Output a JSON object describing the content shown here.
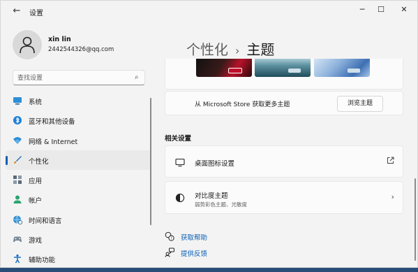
{
  "window": {
    "title": "设置",
    "back_icon": "arrow-left-icon",
    "controls": {
      "minimize": "─",
      "maximize": "☐",
      "close": "✕"
    }
  },
  "user": {
    "name": "xin lin",
    "email": "2442544326@qq.com",
    "avatar_icon": "person-icon"
  },
  "search": {
    "placeholder": "查找设置",
    "icon": "search-icon"
  },
  "sidebar": {
    "items": [
      {
        "label": "系统",
        "icon": "monitor-icon",
        "active": false
      },
      {
        "label": "蓝牙和其他设备",
        "icon": "bluetooth-icon",
        "active": false
      },
      {
        "label": "网络 & Internet",
        "icon": "wifi-icon",
        "active": false
      },
      {
        "label": "个性化",
        "icon": "brush-icon",
        "active": true
      },
      {
        "label": "应用",
        "icon": "apps-icon",
        "active": false
      },
      {
        "label": "帐户",
        "icon": "account-icon",
        "active": false
      },
      {
        "label": "时间和语言",
        "icon": "globe-clock-icon",
        "active": false
      },
      {
        "label": "游戏",
        "icon": "gamepad-icon",
        "active": false
      },
      {
        "label": "辅助功能",
        "icon": "accessibility-icon",
        "active": false
      }
    ]
  },
  "main": {
    "breadcrumb_parent": "个性化",
    "breadcrumb_sep": "›",
    "breadcrumb_current": "主题",
    "store_row": {
      "text": "从 Microsoft Store 获取更多主题",
      "button": "浏览主题"
    },
    "related_section": "相关设置",
    "related": [
      {
        "title": "桌面图标设置",
        "subtitle": "",
        "icon": "desktop-icon",
        "action": "external-link-icon"
      },
      {
        "title": "对比度主题",
        "subtitle": "弱势彩色主题、光敏度",
        "icon": "contrast-icon",
        "action": "chevron-right-icon"
      }
    ],
    "links": [
      {
        "label": "获取帮助",
        "icon": "help-icon"
      },
      {
        "label": "提供反馈",
        "icon": "feedback-icon"
      }
    ]
  },
  "colors": {
    "accent": "#0a5fb4",
    "window_bg": "#f3f3f3",
    "card_bg": "#fbfbfb"
  }
}
